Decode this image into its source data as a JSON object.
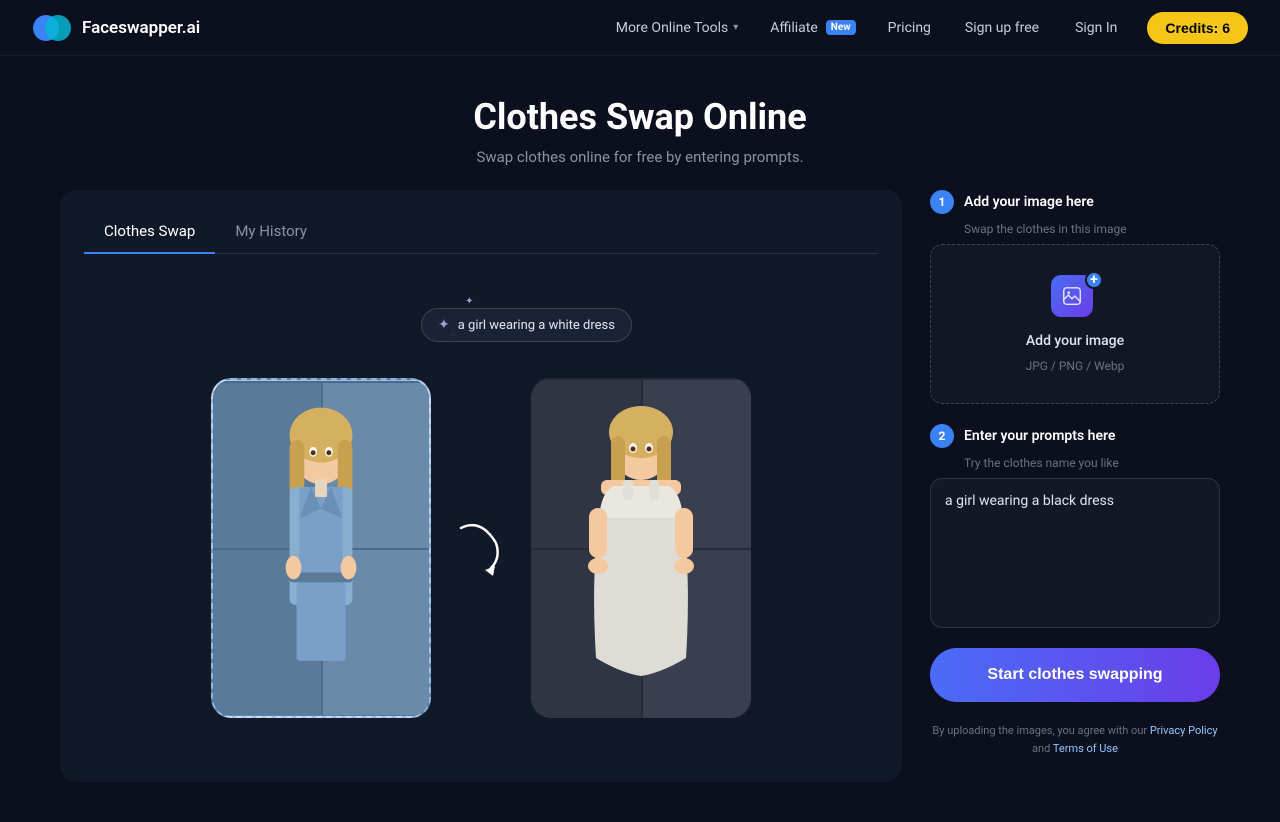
{
  "site": {
    "name": "Faceswapper.ai"
  },
  "navbar": {
    "logo_text": "Faceswapper.ai",
    "links": [
      {
        "label": "More Online Tools",
        "has_chevron": true
      },
      {
        "label": "Affiliate",
        "badge": "New"
      },
      {
        "label": "Pricing"
      },
      {
        "label": "Sign up free"
      },
      {
        "label": "Sign In"
      }
    ],
    "credits_button": "Credits: 6"
  },
  "hero": {
    "title": "Clothes Swap Online",
    "subtitle": "Swap clothes online for free by entering prompts."
  },
  "tabs": [
    {
      "label": "Clothes Swap",
      "active": true
    },
    {
      "label": "My History",
      "active": false
    }
  ],
  "demo": {
    "prompt_bubble": "a girl wearing a white dress"
  },
  "steps": [
    {
      "number": "1",
      "title": "Add your image here",
      "subtitle": "Swap the clothes in this image",
      "upload_label": "Add your image",
      "upload_formats": "JPG / PNG / Webp"
    },
    {
      "number": "2",
      "title": "Enter your prompts here",
      "subtitle": "Try the clothes name you like",
      "prompt_value": "a girl wearing a black dress"
    }
  ],
  "cta": {
    "label": "Start clothes swapping"
  },
  "legal": {
    "text": "By uploading the images, you agree with our ",
    "privacy_label": "Privacy Policy",
    "and": " and ",
    "terms_label": "Terms of Use"
  }
}
